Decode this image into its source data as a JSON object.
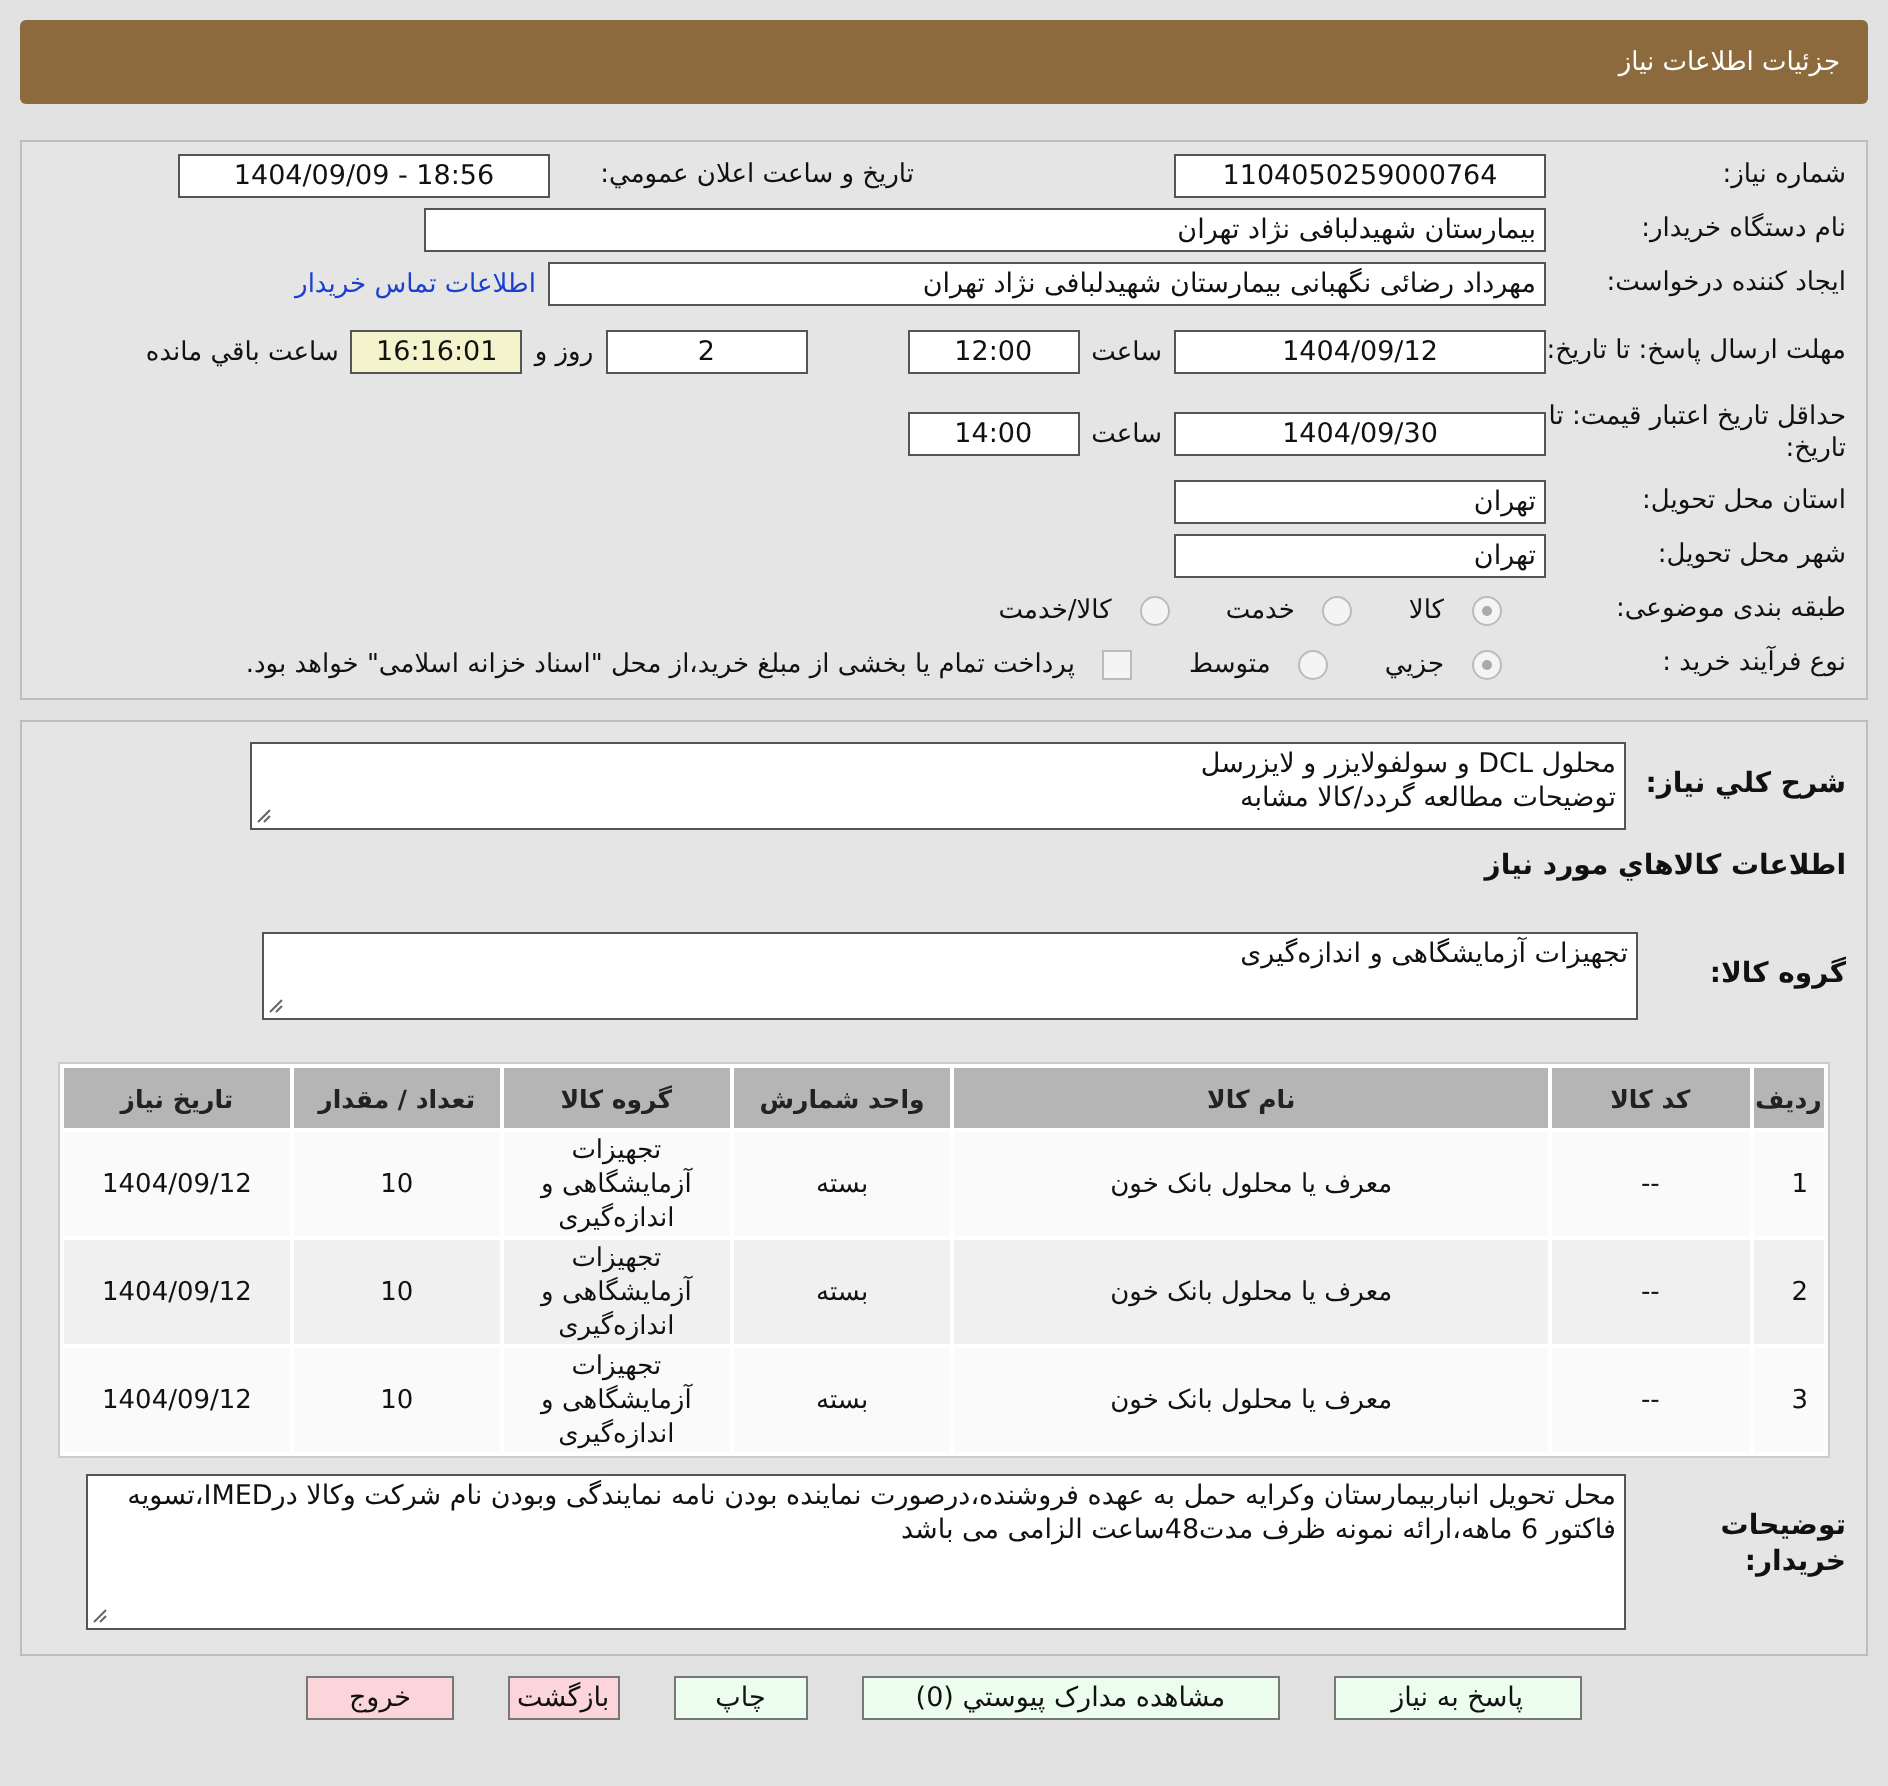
{
  "header": {
    "title": "جزئیات اطلاعات نیاز"
  },
  "need_info": {
    "need_number": {
      "label": "شماره نیاز:",
      "value": "1104050259000764"
    },
    "announce_datetime": {
      "label": "تاریخ و ساعت اعلان عمومي:",
      "value": "1404/09/09 - 18:56"
    },
    "buyer_org": {
      "label": "نام دستگاه خریدار:",
      "value": "بیمارستان شهیدلبافی نژاد تهران"
    },
    "requester": {
      "label": "ایجاد کننده درخواست:",
      "value": "مهرداد رضائی نگهبانی بیمارستان شهیدلبافی نژاد تهران",
      "link": "اطلاعات تماس خریدار"
    },
    "response_deadline": {
      "label": "مهلت ارسال پاسخ: تا تاریخ:",
      "date": "1404/09/12",
      "time_label": "ساعت",
      "time": "12:00",
      "days": "2",
      "days_label": "روز و",
      "remaining": "16:16:01",
      "remaining_label": "ساعت باقي مانده"
    },
    "price_validity": {
      "label": "حداقل تاریخ اعتبار قیمت: تا تاریخ:",
      "date": "1404/09/30",
      "time_label": "ساعت",
      "time": "14:00"
    },
    "province": {
      "label": "استان محل تحویل:",
      "value": "تهران"
    },
    "city": {
      "label": "شهر محل تحویل:",
      "value": "تهران"
    },
    "category": {
      "label": "طبقه بندی موضوعی:",
      "options": [
        {
          "label": "كالا",
          "selected": true
        },
        {
          "label": "خدمت",
          "selected": false
        },
        {
          "label": "كالا/خدمت",
          "selected": false
        }
      ]
    },
    "process": {
      "label": "نوع فرآیند خرید :",
      "options": [
        {
          "label": "جزيي",
          "selected": true
        },
        {
          "label": "متوسط",
          "selected": false
        }
      ],
      "treasury": {
        "checked": false,
        "text": "پرداخت تمام یا بخشی از مبلغ خرید،از محل \"اسناد خزانه اسلامی\" خواهد بود."
      }
    }
  },
  "description": {
    "label": "شرح کلي نياز:",
    "lines": [
      "محلول DCL و سولفولایزر و لایزرسل",
      "توضیحات مطالعه گردد/کالا مشابه"
    ]
  },
  "goods_heading": "اطلاعات کالاهاي مورد نياز",
  "goods_group": {
    "label": "گروه کالا:",
    "value": "تجهیزات آزمایشگاهی و اندازه‌گیری"
  },
  "table": {
    "columns": [
      "ردیف",
      "کد کالا",
      "نام کالا",
      "واحد شمارش",
      "گروه کالا",
      "تعداد / مقدار",
      "تاریخ نیاز"
    ],
    "rows": [
      [
        "1",
        "--",
        "معرف یا محلول بانک خون",
        "بسته",
        "تجهیزات آزمایشگاهی و اندازه‌گیری",
        "10",
        "1404/09/12"
      ],
      [
        "2",
        "--",
        "معرف یا محلول بانک خون",
        "بسته",
        "تجهیزات آزمایشگاهی و اندازه‌گیری",
        "10",
        "1404/09/12"
      ],
      [
        "3",
        "--",
        "معرف یا محلول بانک خون",
        "بسته",
        "تجهیزات آزمایشگاهی و اندازه‌گیری",
        "10",
        "1404/09/12"
      ]
    ]
  },
  "buyer_notes": {
    "label": "توضیحات خریدار:",
    "value": "محل تحویل انباربیمارستان وکرایه حمل به عهده فروشنده،درصورت نماینده بودن نامه نمایندگی وبودن نام شرکت وکالا درIMED،تسویه فاکتور 6 ماهه،ارائه نمونه ظرف مدت48ساعت الزامی می باشد"
  },
  "buttons": [
    {
      "label": "پاسخ به نياز",
      "kind": "action"
    },
    {
      "label": "مشاهده مدارک پيوستي (0)",
      "kind": "action"
    },
    {
      "label": "چاپ",
      "kind": "action"
    },
    {
      "label": "بازگشت",
      "kind": "exit"
    },
    {
      "label": "خروج",
      "kind": "exit"
    }
  ]
}
